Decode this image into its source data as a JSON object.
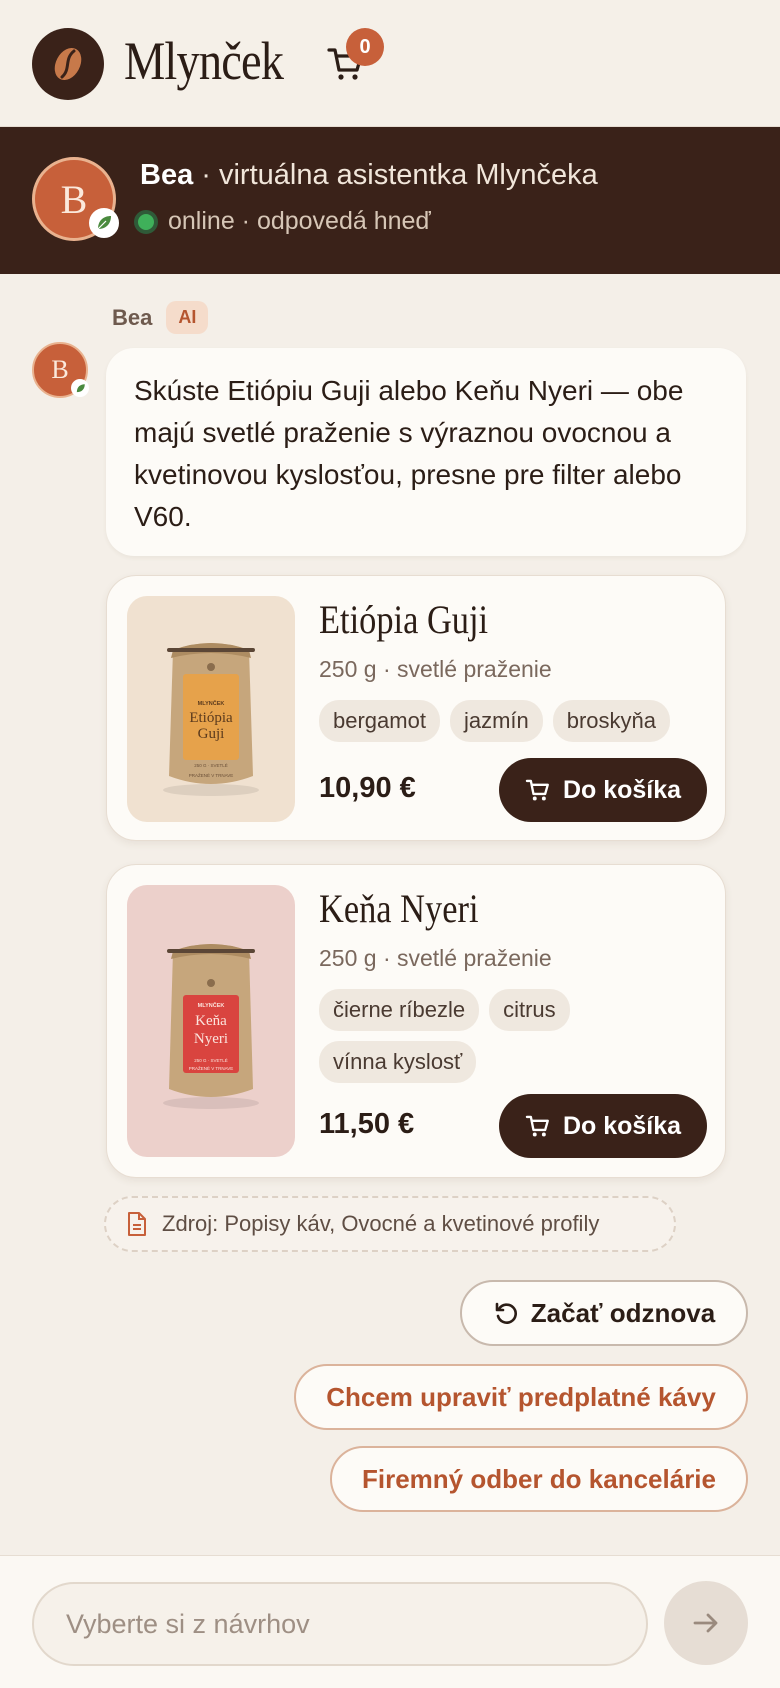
{
  "header": {
    "brand": "Mlynček",
    "logo_icon": "coffee-bean-icon",
    "cart_icon": "cart-icon",
    "cart_count": "0"
  },
  "assistant": {
    "avatar_letter": "B",
    "name": "Bea",
    "title_rest": " · virtuálna asistentka Mlynčeka",
    "status": "online · odpovedá hneď",
    "status_color": "#3fb05a"
  },
  "message": {
    "sender": "Bea",
    "badge": "AI",
    "text": "Skúste Etiópiu Guji alebo Keňu Nyeri — obe majú svetlé praženie s výraznou ovocnou a kvetinovou kyslosťou, presne pre filter alebo V60."
  },
  "products": [
    {
      "name": "Etiópia Guji",
      "meta": "250 g · svetlé praženie",
      "tags": [
        "bergamot",
        "jazmín",
        "broskyňa"
      ],
      "price": "10,90 €",
      "button": "Do košíka",
      "pack_brand": "MLYNČEK",
      "pack_line1": "Etiópia",
      "pack_line2": "Guji",
      "pack_foot1": "250 G · SVETLÉ",
      "pack_foot2": "PRAŽENÉ V TRNAVE",
      "bg_color": "#f0e1d0",
      "label_color": "#e6a24b"
    },
    {
      "name": "Keňa Nyeri",
      "meta": "250 g · svetlé praženie",
      "tags": [
        "čierne ríbezle",
        "citrus",
        "vínna kyslosť"
      ],
      "price": "11,50 €",
      "button": "Do košíka",
      "pack_brand": "MLYNČEK",
      "pack_line1": "Keňa",
      "pack_line2": "Nyeri",
      "pack_foot1": "250 G · SVETLÉ",
      "pack_foot2": "PRAŽENÉ V TRNAVE",
      "bg_color": "#ecd0cb",
      "label_color": "#d9443f"
    }
  ],
  "source": {
    "icon": "document-icon",
    "text": "Zdroj: Popisy káv, Ovocné a kvetinové profily"
  },
  "suggestions": {
    "restart_icon": "refresh-icon",
    "restart": "Začať odznova",
    "items": [
      "Chcem upraviť predplatné kávy",
      "Firemný odber do kancelárie"
    ]
  },
  "composer": {
    "placeholder": "Vyberte si z návrhov",
    "send_icon": "arrow-right-icon"
  }
}
